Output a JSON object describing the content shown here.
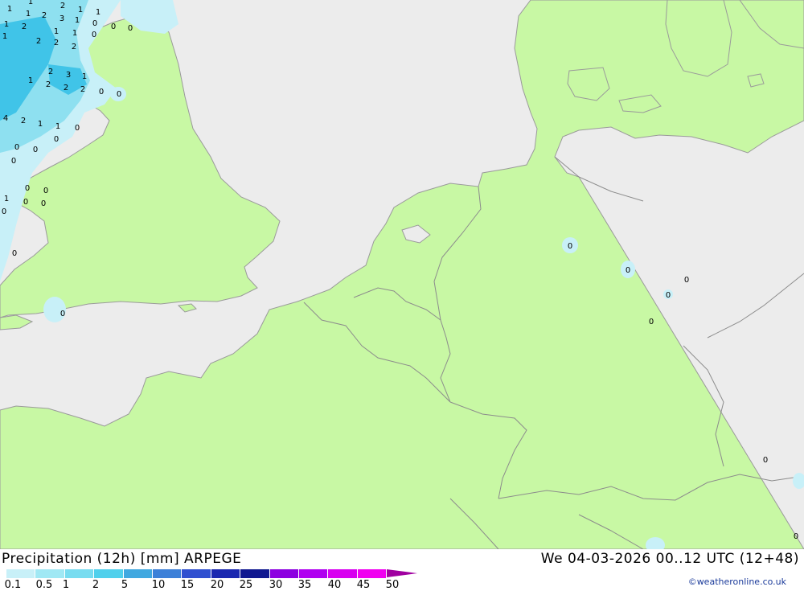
{
  "map": {
    "title_left": "Precipitation (12h) [mm] ARPEGE",
    "datetime": "We 04-03-2026 00..12 UTC (12+48)",
    "credit": "©weatheronline.co.uk",
    "colors": {
      "sea": "#ececec",
      "land": "#c8f8a4",
      "border": "#9a9a9a",
      "rain_light": "#c8f0f8",
      "rain_mid": "#8ee0f0",
      "rain_heavy": "#40c4e8"
    }
  },
  "legend": {
    "labels": [
      "0.1",
      "0.5",
      "1",
      "2",
      "5",
      "10",
      "15",
      "20",
      "25",
      "30",
      "35",
      "40",
      "45",
      "50"
    ],
    "colors": [
      "#c8f0f8",
      "#a0e8f4",
      "#78dcf0",
      "#50d0ec",
      "#40a8e0",
      "#3c80d8",
      "#3050d0",
      "#1a28b0",
      "#101890",
      "#8c00e0",
      "#b000f0",
      "#d800f0",
      "#f000f0",
      "#c000c0"
    ]
  },
  "precip_labels": [
    {
      "v": "1"
    },
    {
      "v": "2"
    },
    {
      "v": "1"
    },
    {
      "v": "1"
    },
    {
      "v": "1"
    },
    {
      "v": "1"
    },
    {
      "v": "2"
    },
    {
      "v": "3"
    },
    {
      "v": "1"
    },
    {
      "v": "0"
    },
    {
      "v": "1"
    },
    {
      "v": "2"
    },
    {
      "v": "2"
    },
    {
      "v": "1"
    },
    {
      "v": "0"
    },
    {
      "v": "1"
    },
    {
      "v": "2"
    },
    {
      "v": "2"
    },
    {
      "v": "0"
    },
    {
      "v": "0"
    },
    {
      "v": "1"
    },
    {
      "v": "2"
    },
    {
      "v": "3"
    },
    {
      "v": "1"
    },
    {
      "v": "1"
    },
    {
      "v": "2"
    },
    {
      "v": "2"
    },
    {
      "v": "2"
    },
    {
      "v": "0"
    },
    {
      "v": "4"
    },
    {
      "v": "2"
    },
    {
      "v": "1"
    },
    {
      "v": "1"
    },
    {
      "v": "0"
    },
    {
      "v": "0"
    },
    {
      "v": "0"
    },
    {
      "v": "0"
    },
    {
      "v": "0"
    },
    {
      "v": "1"
    },
    {
      "v": "0"
    },
    {
      "v": "0"
    },
    {
      "v": "0"
    },
    {
      "v": "0"
    },
    {
      "v": "0"
    },
    {
      "v": "0"
    },
    {
      "v": "0"
    },
    {
      "v": "0"
    },
    {
      "v": "0"
    },
    {
      "v": "0"
    },
    {
      "v": "0"
    },
    {
      "v": "0"
    },
    {
      "v": "0"
    },
    {
      "v": "0"
    },
    {
      "v": "0"
    }
  ]
}
